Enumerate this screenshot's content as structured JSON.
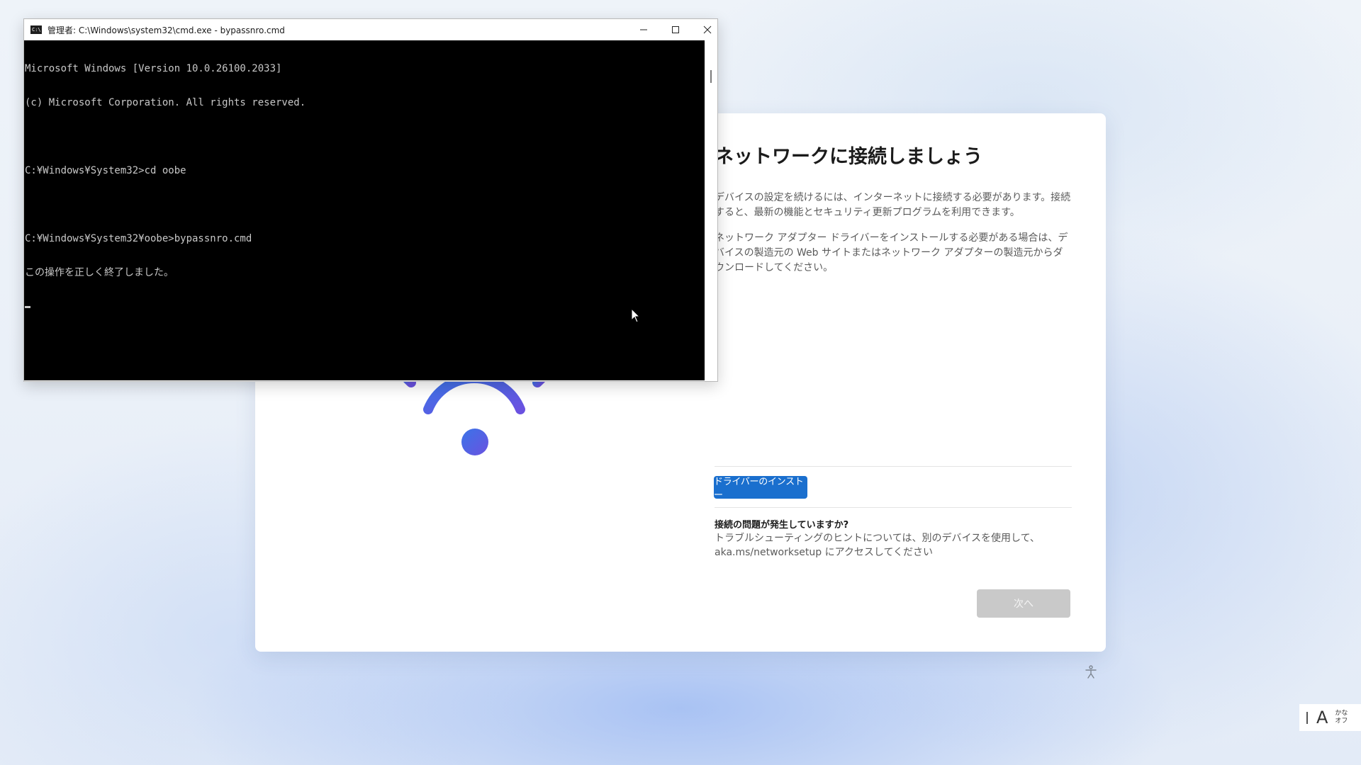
{
  "cmd": {
    "title": "管理者: C:\\Windows\\system32\\cmd.exe - bypassnro.cmd",
    "icon": "console-icon",
    "lines": [
      "Microsoft Windows [Version 10.0.26100.2033]",
      "(c) Microsoft Corporation. All rights reserved.",
      "",
      "C:¥Windows¥System32>cd oobe",
      "",
      "C:¥Windows¥System32¥oobe>bypassnro.cmd",
      "この操作を正しく終了しました。"
    ]
  },
  "oobe": {
    "title": "ネットワークに接続しましょう",
    "para1": "デバイスの設定を続けるには、インターネットに接続する必要があります。接続すると、最新の機能とセキュリティ更新プログラムを利用できます。",
    "para2": "ネットワーク アダプター ドライバーをインストールする必要がある場合は、デバイスの製造元の Web サイトまたはネットワーク アダプターの製造元からダウンロードしてください。",
    "driver_button": "ドライバーのインストー",
    "issue_title": "接続の問題が発生していますか?",
    "issue_text": "トラブルシューティングのヒントについては、別のデバイスを使用して、aka.ms/networksetup にアクセスしてください",
    "next_button": "次へ",
    "accent_color": "#1a6fce"
  },
  "ime": {
    "mode": "A",
    "kana_line1": "かな",
    "kana_line2": "オフ"
  }
}
